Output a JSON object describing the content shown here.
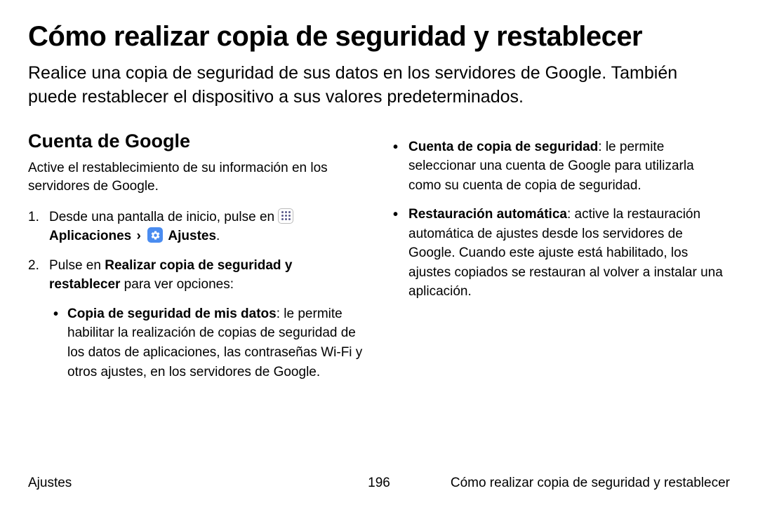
{
  "title": "Cómo realizar copia de seguridad y restablecer",
  "intro": "Realice una copia de seguridad de sus datos en los servidores de Google. También puede restablecer el dispositivo a sus valores predeterminados.",
  "left": {
    "heading": "Cuenta de Google",
    "intro": "Active el restablecimiento de su información en los servidores de Google.",
    "step1_prefix": "Desde una pantalla de inicio, pulse en ",
    "step1_apps": "Aplicaciones",
    "step1_settings": "Ajustes",
    "step1_period": ".",
    "step2_prefix": "Pulse en ",
    "step2_bold": "Realizar copia de seguridad y restablecer",
    "step2_suffix": " para ver opciones:",
    "bullet1_bold": "Copia de seguridad de mis datos",
    "bullet1_text": ": le permite habilitar la realización de copias de seguridad de los datos de aplicaciones, las contraseñas Wi-Fi y otros ajustes, en los servidores de Google."
  },
  "right": {
    "bullet1_bold": "Cuenta de copia de seguridad",
    "bullet1_text": ": le permite seleccionar una cuenta de Google para utilizarla como su cuenta de copia de seguridad.",
    "bullet2_bold": "Restauración automática",
    "bullet2_text": ": active la restauración automática de ajustes desde los servidores de Google. Cuando este ajuste está habilitado, los ajustes copiados se restauran al volver a instalar una aplicación."
  },
  "footer": {
    "left": "Ajustes",
    "center": "196",
    "right": "Cómo realizar copia de seguridad y restablecer"
  }
}
